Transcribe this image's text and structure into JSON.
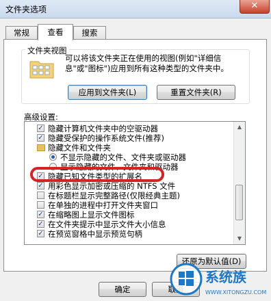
{
  "window": {
    "title": "文件夹选项",
    "close_glyph": "✕"
  },
  "tabs": [
    {
      "label": "常规",
      "active": false
    },
    {
      "label": "查看",
      "active": true
    },
    {
      "label": "搜索",
      "active": false
    }
  ],
  "folder_views": {
    "group_label": "文件夹视图",
    "description": "可以将该文件夹正在使用的视图(例如\"详细信息\"或\"图标\")应用到所有这种类型的文件夹中。",
    "apply_button": "应用到文件夹(L)",
    "reset_button": "重置文件夹(R)"
  },
  "advanced": {
    "label": "高级设置:",
    "items": [
      {
        "type": "checkbox",
        "checked": true,
        "indent": 1,
        "label": "隐藏计算机文件夹中的空驱动器"
      },
      {
        "type": "checkbox",
        "checked": true,
        "indent": 1,
        "label": "隐藏受保护的操作系统文件(推荐)"
      },
      {
        "type": "folder",
        "indent": 1,
        "label": "隐藏文件和文件夹"
      },
      {
        "type": "radio",
        "checked": true,
        "indent": 2,
        "label": "不显示隐藏的文件、文件夹或驱动器"
      },
      {
        "type": "radio",
        "checked": false,
        "indent": 2,
        "label": "显示隐藏的文件、文件夹和驱动器"
      },
      {
        "type": "checkbox",
        "checked": true,
        "indent": 1,
        "label": "隐藏已知文件类型的扩展名"
      },
      {
        "type": "checkbox",
        "checked": true,
        "indent": 1,
        "label": "用彩色显示加密或压缩的 NTFS 文件"
      },
      {
        "type": "checkbox",
        "checked": false,
        "indent": 1,
        "label": "在标题栏显示完整路径(仅限经典主题)"
      },
      {
        "type": "checkbox",
        "checked": false,
        "indent": 1,
        "label": "在单独的进程中打开文件夹窗口"
      },
      {
        "type": "checkbox",
        "checked": true,
        "indent": 1,
        "label": "在缩略图上显示文件图标"
      },
      {
        "type": "checkbox",
        "checked": true,
        "indent": 1,
        "label": "在文件夹提示中显示文件大小信息"
      },
      {
        "type": "checkbox",
        "checked": true,
        "indent": 1,
        "label": "在预览窗格中显示预览句柄"
      }
    ],
    "restore_button": "还原为默认值(D)"
  },
  "footer": {
    "ok_button": "确定",
    "cancel_button": "取消"
  },
  "watermark": {
    "brand": "系统族",
    "url": "WWW.XITONGZU.COM"
  },
  "colors": {
    "highlight": "#d52222",
    "logo_blue": "#1e78c8"
  }
}
